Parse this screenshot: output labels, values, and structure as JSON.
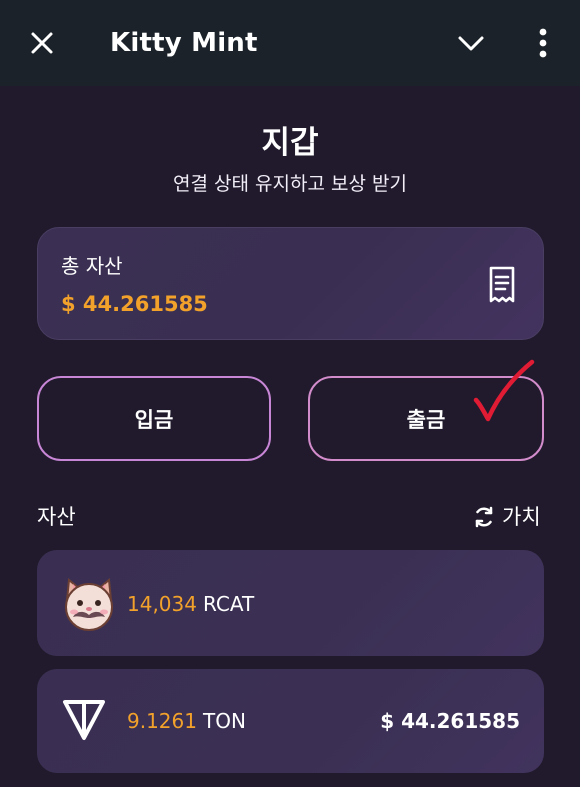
{
  "header": {
    "title": "Kitty Mint",
    "icons": [
      "close-icon",
      "chevron-down-icon",
      "more-vertical-icon"
    ]
  },
  "wallet": {
    "title": "지갑",
    "subtitle": "연결 상태 유지하고 보상 받기"
  },
  "total": {
    "label": "총 자산",
    "value": "$ 44.261585",
    "icon": "receipt-icon"
  },
  "actions": {
    "deposit_label": "입금",
    "withdraw_label": "출금"
  },
  "assets": {
    "heading": "자산",
    "toggle_label": "가치",
    "toggle_icon": "refresh-icon",
    "items": [
      {
        "amount": "14,034",
        "symbol": "RCAT",
        "fiat": "",
        "icon": "rcat-cat-icon"
      },
      {
        "amount": "9.1261",
        "symbol": "TON",
        "fiat": "$ 44.261585",
        "icon": "ton-icon"
      }
    ]
  },
  "colors": {
    "background": "#201a2c",
    "topbar": "#1b2229",
    "accent_orange": "#f2a22a",
    "card": "#3a2f52",
    "button_border": "#c886d6",
    "checkmark": "#e01b34"
  }
}
